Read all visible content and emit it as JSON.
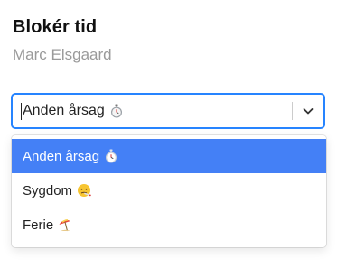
{
  "header": {
    "title": "Blokér tid",
    "subtitle": "Marc Elsgaard"
  },
  "select": {
    "value": "Anden årsag",
    "value_icon": "stopwatch-icon",
    "indicator_icon": "chevron-down-icon",
    "accent_color": "#2684ff"
  },
  "menu": {
    "selected_color": "#4480f6",
    "options": [
      {
        "label": "Anden årsag",
        "icon": "stopwatch-icon",
        "selected": true
      },
      {
        "label": "Sygdom",
        "icon": "face-with-thermometer-icon",
        "selected": false
      },
      {
        "label": "Ferie",
        "icon": "beach-umbrella-icon",
        "selected": false
      }
    ]
  }
}
